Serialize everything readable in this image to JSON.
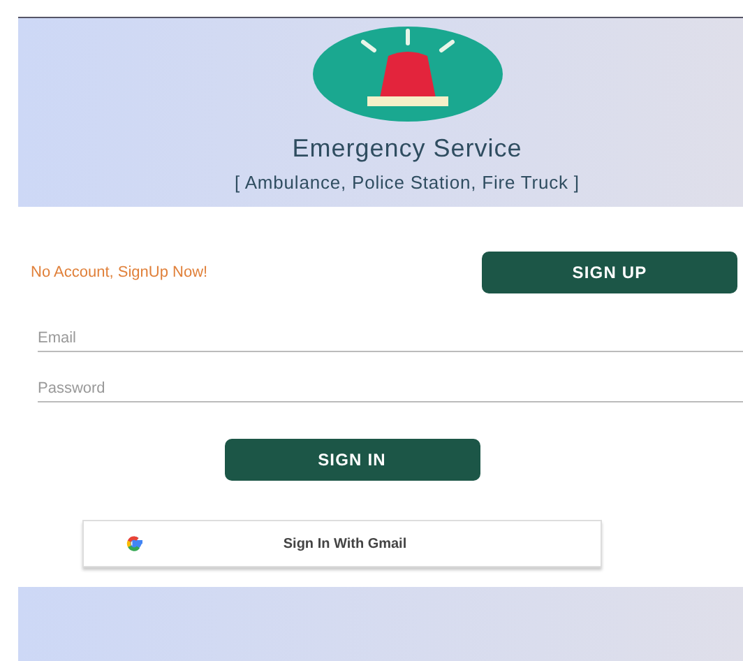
{
  "header": {
    "title": "Emergency Service",
    "subtitle": "[ Ambulance, Police Station, Fire Truck ]"
  },
  "signup": {
    "prompt": "No Account, SignUp Now!",
    "button": "SIGN UP"
  },
  "fields": [
    {
      "placeholder": "Email"
    },
    {
      "placeholder": "Password"
    }
  ],
  "sign_in_button": "SIGN IN",
  "gmail_button": "Sign In With Gmail"
}
